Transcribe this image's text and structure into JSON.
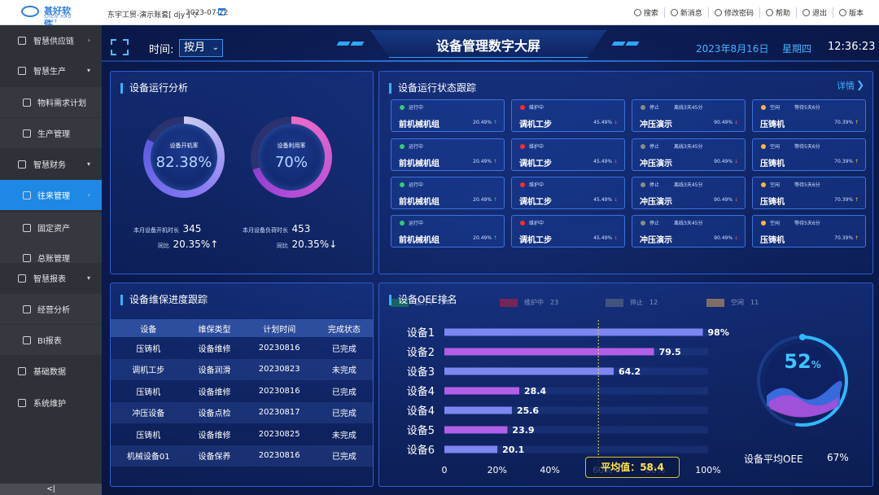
{
  "topbar": {
    "brand": "甚好软件",
    "brand_sub": "SHEN HAO SOFT",
    "company": "东宇工贸-演示账套[ djy ]",
    "company_caret": "▽",
    "date": "2023-07-22",
    "tools": [
      {
        "label": "搜索",
        "icon": "search-icon"
      },
      {
        "label": "新消息",
        "icon": "message-icon"
      },
      {
        "label": "修改密码",
        "icon": "lock-icon"
      },
      {
        "label": "帮助",
        "icon": "help-icon"
      },
      {
        "label": "退出",
        "icon": "power-icon"
      },
      {
        "label": "版本",
        "icon": "info-icon"
      }
    ]
  },
  "sidebar": {
    "items": [
      {
        "label": "智慧供应链",
        "level": 1,
        "arrow": "›"
      },
      {
        "label": "智慧生产",
        "level": 1,
        "arrow": "▾"
      },
      {
        "label": "物料需求计划",
        "level": 2
      },
      {
        "label": "生产管理",
        "level": 2
      },
      {
        "label": "智慧财务",
        "level": 1,
        "arrow": "▾"
      },
      {
        "label": "往来管理",
        "level": 2,
        "active": true,
        "arrow": "›"
      },
      {
        "label": "固定资产",
        "level": 2
      },
      {
        "label": "总账管理",
        "level": 2
      },
      {
        "label": "智慧报表",
        "level": 1,
        "arrow": "▾"
      },
      {
        "label": "经营分析",
        "level": 2
      },
      {
        "label": "BI报表",
        "level": 2
      },
      {
        "label": "基础数据",
        "level": 1
      },
      {
        "label": "系统维护",
        "level": 1
      }
    ],
    "collapse_label": "<|"
  },
  "header": {
    "title": "设备管理数字大屏",
    "time_label": "时间:",
    "time_select": "按月",
    "time_caret": "⌄",
    "date": "2023年8月16日",
    "weekday": "星期四",
    "clock": "12:36:23"
  },
  "analysis": {
    "title": "设备运行分析",
    "gauge1": {
      "label": "设备开机率",
      "value": "82.38%",
      "percent": 82.38
    },
    "gauge2": {
      "label": "设备利用率",
      "value": "70%",
      "percent": 70
    },
    "stat1": {
      "label": "本月设备开机时长",
      "value": "345",
      "yoy_label": "同比",
      "yoy": "20.35%",
      "arrow": "↑"
    },
    "stat2": {
      "label": "本月设备负荷时长",
      "value": "453",
      "yoy_label": "同比",
      "yoy": "20.35%",
      "arrow": "↓"
    }
  },
  "tracking": {
    "title": "设备运行状态跟踪",
    "details": "详情",
    "details_chevron": "❯",
    "rows": [
      [
        {
          "status": "运行中",
          "name": "前机械机组",
          "pct": "20.49%",
          "arrow": "↑",
          "color": "#2fcf6e"
        },
        {
          "status": "维护中",
          "name": "调机工步",
          "pct": "45.49%",
          "arrow": "↓",
          "color": "#ff2a2a"
        },
        {
          "status": "停止",
          "extra": "离线3天45分",
          "name": "冲压演示",
          "pct": "90.49%",
          "arrow": "↓",
          "color": "#8b8b8b"
        },
        {
          "status": "空闲",
          "extra": "等待5天6分",
          "name": "压铸机",
          "pct": "70.39%",
          "arrow": "↑",
          "color": "#ffb43f"
        }
      ],
      [
        {
          "status": "运行中",
          "name": "前机械机组",
          "pct": "20.49%",
          "arrow": "↑",
          "color": "#2fcf6e"
        },
        {
          "status": "维护中",
          "name": "调机工步",
          "pct": "45.49%",
          "arrow": "↓",
          "color": "#ff2a2a"
        },
        {
          "status": "停止",
          "extra": "离线3天45分",
          "name": "冲压演示",
          "pct": "90.49%",
          "arrow": "↓",
          "color": "#8b8b8b"
        },
        {
          "status": "空闲",
          "extra": "等待5天6分",
          "name": "压铸机",
          "pct": "70.39%",
          "arrow": "↑",
          "color": "#ffb43f"
        }
      ],
      [
        {
          "status": "运行中",
          "name": "前机械机组",
          "pct": "20.49%",
          "arrow": "↑",
          "color": "#2fcf6e"
        },
        {
          "status": "维护中",
          "name": "调机工步",
          "pct": "45.49%",
          "arrow": "↓",
          "color": "#ff2a2a"
        },
        {
          "status": "停止",
          "extra": "离线3天45分",
          "name": "冲压演示",
          "pct": "90.49%",
          "arrow": "↓",
          "color": "#8b8b8b"
        },
        {
          "status": "空闲",
          "extra": "等待5天6分",
          "name": "压铸机",
          "pct": "70.39%",
          "arrow": "↑",
          "color": "#ffb43f"
        }
      ],
      [
        {
          "status": "运行中",
          "name": "前机械机组",
          "pct": "20.49%",
          "arrow": "↑",
          "color": "#2fcf6e"
        },
        {
          "status": "维护中",
          "name": "调机工步",
          "pct": "45.49%",
          "arrow": "↓",
          "color": "#ff2a2a"
        },
        {
          "status": "停止",
          "extra": "离线3天45分",
          "name": "冲压演示",
          "pct": "90.49%",
          "arrow": "↓",
          "color": "#8b8b8b"
        },
        {
          "status": "空闲",
          "extra": "等待5天6分",
          "name": "压铸机",
          "pct": "70.39%",
          "arrow": "↑",
          "color": "#ffb43f"
        }
      ]
    ],
    "legend": [
      {
        "label": "运行中",
        "count": "34",
        "color": "#1a9b3d"
      },
      {
        "label": "维护中",
        "count": "23",
        "color": "#e8121c"
      },
      {
        "label": "停止",
        "count": "12",
        "color": "#777777"
      },
      {
        "label": "空闲",
        "count": "11",
        "color": "#ffb43f"
      }
    ]
  },
  "maintenance": {
    "title": "设备维保进度跟踪",
    "columns": [
      "设备",
      "维保类型",
      "计划时间",
      "完成状态"
    ],
    "rows": [
      [
        "压铸机",
        "设备维修",
        "20230816",
        "已完成"
      ],
      [
        "调机工步",
        "设备润滑",
        "20230823",
        "未完成"
      ],
      [
        "压铸机",
        "设备维修",
        "20230816",
        "已完成"
      ],
      [
        "冲压设备",
        "设备点检",
        "20230817",
        "已完成"
      ],
      [
        "压铸机",
        "设备维修",
        "20230825",
        "未完成"
      ],
      [
        "机械设备01",
        "设备保养",
        "20230816",
        "已完成"
      ]
    ]
  },
  "oee": {
    "title": "设备OEE排名",
    "avg_box": "平均值：58.4",
    "ring_value": "52",
    "ring_unit": "%",
    "ring_percent": 52,
    "avg_label": "设备平均OEE",
    "avg_value": "67%"
  },
  "chart_data": {
    "type": "bar",
    "orientation": "horizontal",
    "categories": [
      "设备1",
      "设备2",
      "设备3",
      "设备4",
      "设备4",
      "设备5",
      "设备6"
    ],
    "values": [
      98,
      79.5,
      64.2,
      28.4,
      25.6,
      23.9,
      20.1
    ],
    "value_labels": [
      "98%",
      "79.5",
      "64.2",
      "28.4",
      "25.6",
      "23.9",
      "20.1"
    ],
    "xticks": [
      "0",
      "20%",
      "40%",
      "60%",
      "80%",
      "100%"
    ],
    "xlim": [
      0,
      100
    ],
    "average": 58.4,
    "bar_colors": [
      "#7e86f2",
      "#b35fe6"
    ]
  }
}
